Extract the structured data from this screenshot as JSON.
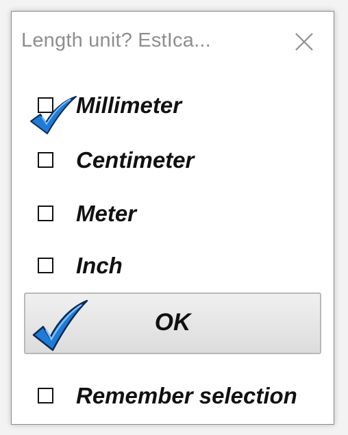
{
  "dialog": {
    "title": "Length unit? EstIca...",
    "close_icon": "close-icon"
  },
  "options": [
    {
      "label": "Millimeter",
      "checked": true
    },
    {
      "label": "Centimeter",
      "checked": false
    },
    {
      "label": "Meter",
      "checked": false
    },
    {
      "label": "Inch",
      "checked": false
    }
  ],
  "ok_button": {
    "label": "OK",
    "icon": "checkmark-icon"
  },
  "remember": {
    "label": "Remember selection",
    "checked": false
  },
  "colors": {
    "check_blue": "#1f7bd6",
    "check_outline": "#0a2a52"
  }
}
